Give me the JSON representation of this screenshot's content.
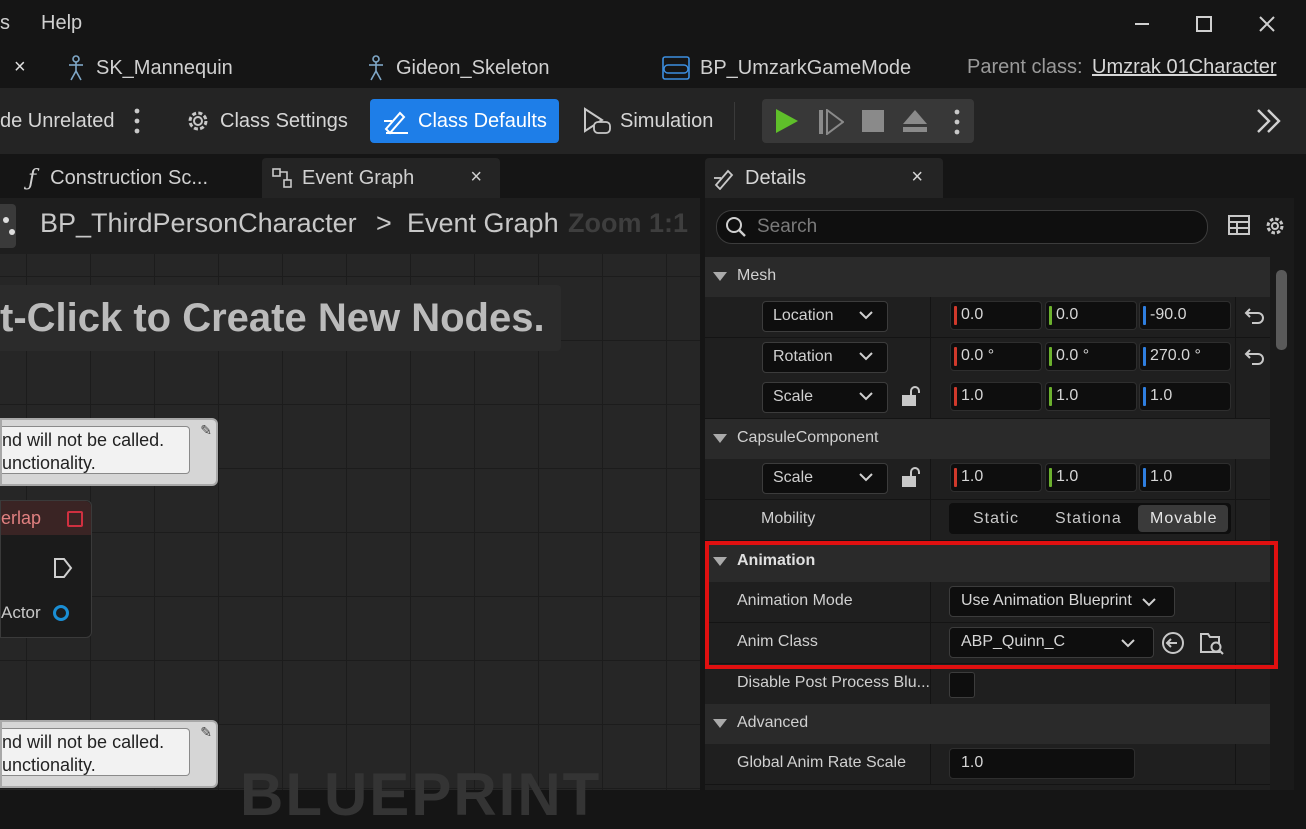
{
  "menu": {
    "left_fragment": "s",
    "help": "Help"
  },
  "window": {
    "min": "—",
    "max": "☐",
    "close": "✕"
  },
  "asset_tabs": {
    "close_glyph": "×",
    "items": [
      {
        "label": "SK_Mannequin"
      },
      {
        "label": "Gideon_Skeleton"
      },
      {
        "label": "BP_UmzarkGameMode"
      }
    ],
    "parent_class_label": "Parent class:",
    "parent_class_value": "Umzrak 01Character"
  },
  "toolbar": {
    "hide_unrelated": "de Unrelated",
    "class_settings": "Class Settings",
    "class_defaults": "Class Defaults",
    "simulation": "Simulation"
  },
  "graph_tabs": {
    "construction": "Construction Sc...",
    "event_graph": "Event Graph",
    "close_glyph": "×"
  },
  "breadcrumb": {
    "blueprint": "BP_ThirdPersonCharacter",
    "separator": ">",
    "graph": "Event Graph",
    "zoom": "Zoom 1:1"
  },
  "graph": {
    "hint": "t-Click to Create New Nodes.",
    "comment1_line1": "nd will not be called.",
    "comment1_line2": "unctionality.",
    "comment2_line1": "nd will not be called.",
    "comment2_line2": "unctionality.",
    "node_title": "erlap",
    "node_pin": "Actor",
    "watermark": "BLUEPRINT"
  },
  "details": {
    "tab_label": "Details",
    "close_glyph": "×",
    "search_placeholder": "Search",
    "categories": {
      "mesh": "Mesh",
      "capsule": "CapsuleComponent",
      "animation": "Animation",
      "advanced": "Advanced"
    },
    "mesh": {
      "location": {
        "label": "Location",
        "x": "0.0",
        "y": "0.0",
        "z": "-90.0"
      },
      "rotation": {
        "label": "Rotation",
        "x": "0.0 °",
        "y": "0.0 °",
        "z": "270.0 °"
      },
      "scale": {
        "label": "Scale",
        "x": "1.0",
        "y": "1.0",
        "z": "1.0"
      }
    },
    "capsule": {
      "scale": {
        "label": "Scale",
        "x": "1.0",
        "y": "1.0",
        "z": "1.0"
      },
      "mobility_label": "Mobility",
      "mobility_options": [
        "Static",
        "Stationa",
        "Movable"
      ],
      "mobility_selected": "Movable"
    },
    "animation": {
      "mode_label": "Animation Mode",
      "mode_value": "Use Animation Blueprint",
      "class_label": "Anim Class",
      "class_value": "ABP_Quinn_C",
      "disable_pp_label": "Disable Post Process Blu..."
    },
    "advanced": {
      "rate_label": "Global Anim Rate Scale",
      "rate_value": "1.0"
    }
  },
  "colors": {
    "accent_blue": "#1e7ee8",
    "axis_x": "#d0392b",
    "axis_y": "#6cb12e",
    "axis_z": "#2f7fe0",
    "highlight": "#e01010",
    "play_green": "#5fbf2a"
  }
}
